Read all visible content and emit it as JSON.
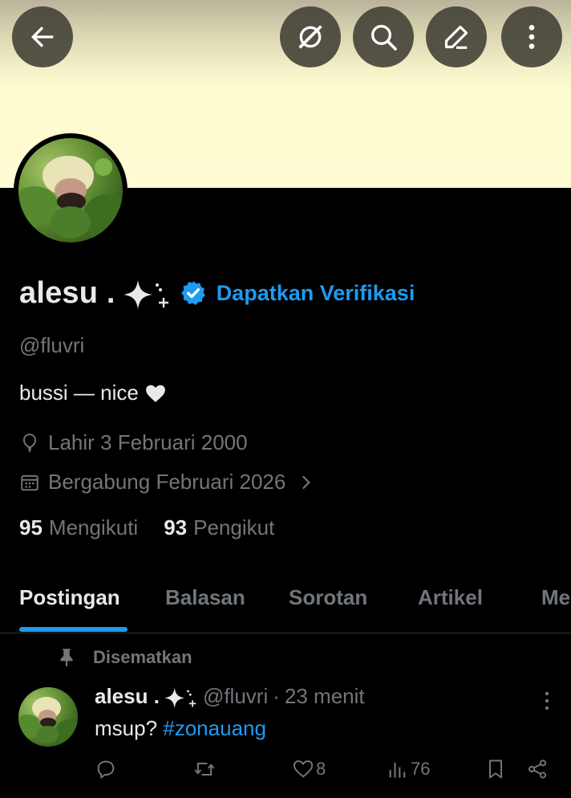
{
  "profile": {
    "display_name": "alesu .",
    "handle": "@fluvri",
    "get_verified_label": "Dapatkan Verifikasi",
    "bio": "bussi — nice",
    "birthday": "Lahir 3 Februari 2000",
    "joined": "Bergabung Februari 2026",
    "following_count": "95",
    "following_label": "Mengikuti",
    "followers_count": "93",
    "followers_label": "Pengikut"
  },
  "tabs": [
    {
      "label": "Postingan",
      "active": true
    },
    {
      "label": "Balasan"
    },
    {
      "label": "Sorotan"
    },
    {
      "label": "Artikel"
    },
    {
      "label": "Me"
    }
  ],
  "pinned_post": {
    "pinned_label": "Disematkan",
    "author_name": "alesu .",
    "author_handle": "@fluvri",
    "separator": "·",
    "time": "23 menit",
    "text": "msup? ",
    "hashtag": "#zonauang",
    "likes": "8",
    "views": "76"
  },
  "icons": {
    "back": "arrow-left-icon",
    "grok": "grok-icon",
    "search": "search-icon",
    "edit": "edit-icon",
    "more": "more-vertical-icon"
  },
  "colors": {
    "accent": "#1d9bf0",
    "text": "#e7e9ea",
    "muted": "#71767b",
    "banner": "#fffbd2"
  }
}
